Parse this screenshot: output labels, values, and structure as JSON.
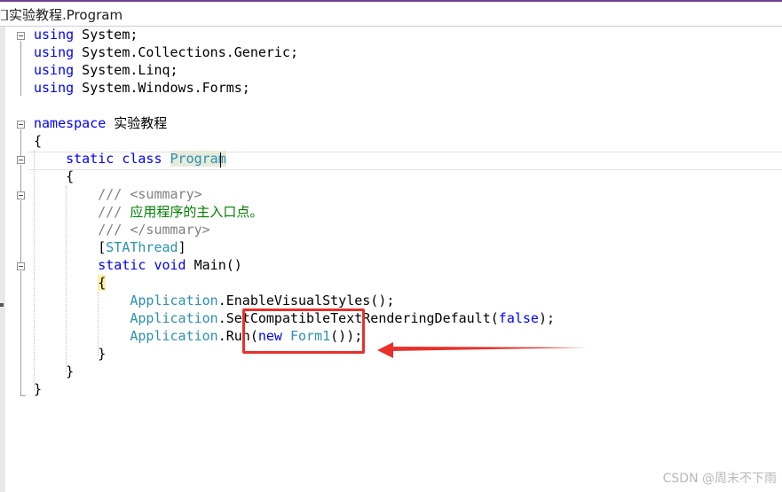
{
  "tab": {
    "title": "实验教程.Program"
  },
  "code_lines": [
    [
      {
        "t": "using",
        "c": "kw"
      },
      {
        "t": " System;",
        "c": ""
      }
    ],
    [
      {
        "t": "using",
        "c": "kw"
      },
      {
        "t": " System.Collections.Generic;",
        "c": ""
      }
    ],
    [
      {
        "t": "using",
        "c": "kw"
      },
      {
        "t": " System.Linq;",
        "c": ""
      }
    ],
    [
      {
        "t": "using",
        "c": "kw"
      },
      {
        "t": " System.Windows.Forms;",
        "c": ""
      }
    ],
    [],
    [
      {
        "t": "namespace",
        "c": "kw"
      },
      {
        "t": " 实验教程",
        "c": ""
      }
    ],
    [
      {
        "t": "{",
        "c": ""
      }
    ],
    [
      {
        "t": "    ",
        "c": ""
      },
      {
        "t": "static",
        "c": "kw"
      },
      {
        "t": " ",
        "c": ""
      },
      {
        "t": "class",
        "c": "kw"
      },
      {
        "t": " ",
        "c": ""
      },
      {
        "t": "Program",
        "c": "ty prog-hl"
      }
    ],
    [
      {
        "t": "    {",
        "c": ""
      }
    ],
    [
      {
        "t": "        ",
        "c": ""
      },
      {
        "t": "/// <summary>",
        "c": "cg"
      }
    ],
    [
      {
        "t": "        ",
        "c": ""
      },
      {
        "t": "///",
        "c": "cg"
      },
      {
        "t": " 应用程序的主入口点。",
        "c": "cm"
      }
    ],
    [
      {
        "t": "        ",
        "c": ""
      },
      {
        "t": "/// </summary>",
        "c": "cg"
      }
    ],
    [
      {
        "t": "        [",
        "c": ""
      },
      {
        "t": "STAThread",
        "c": "ty"
      },
      {
        "t": "]",
        "c": ""
      }
    ],
    [
      {
        "t": "        ",
        "c": ""
      },
      {
        "t": "static",
        "c": "kw"
      },
      {
        "t": " ",
        "c": ""
      },
      {
        "t": "void",
        "c": "kw"
      },
      {
        "t": " Main()",
        "c": ""
      }
    ],
    [
      {
        "t": "        ",
        "c": ""
      },
      {
        "t": "{",
        "c": "brace-hl"
      }
    ],
    [
      {
        "t": "            ",
        "c": ""
      },
      {
        "t": "Application",
        "c": "ty"
      },
      {
        "t": ".EnableVisualStyles();",
        "c": ""
      }
    ],
    [
      {
        "t": "            ",
        "c": ""
      },
      {
        "t": "Application",
        "c": "ty"
      },
      {
        "t": ".SetCompatibleTextRenderingDefault(",
        "c": ""
      },
      {
        "t": "false",
        "c": "kw"
      },
      {
        "t": ");",
        "c": ""
      }
    ],
    [
      {
        "t": "            ",
        "c": ""
      },
      {
        "t": "Application",
        "c": "ty"
      },
      {
        "t": ".Run(",
        "c": ""
      },
      {
        "t": "new",
        "c": "kw"
      },
      {
        "t": " ",
        "c": ""
      },
      {
        "t": "Form1",
        "c": "ty"
      },
      {
        "t": "());",
        "c": ""
      }
    ],
    [
      {
        "t": "        }",
        "c": ""
      }
    ],
    [
      {
        "t": "    }",
        "c": ""
      }
    ],
    [
      {
        "t": "}",
        "c": ""
      }
    ]
  ],
  "watermark": "CSDN @周末不下雨",
  "colors": {
    "keyword": "#0000ff",
    "type": "#2b91af",
    "comment": "#008000",
    "doc_tag": "#808080",
    "annotation": "#e8302c",
    "title_accent": "#6f3f95"
  },
  "annotation": {
    "shape": "red-box-with-arrow",
    "points_to": "new Form1()"
  }
}
